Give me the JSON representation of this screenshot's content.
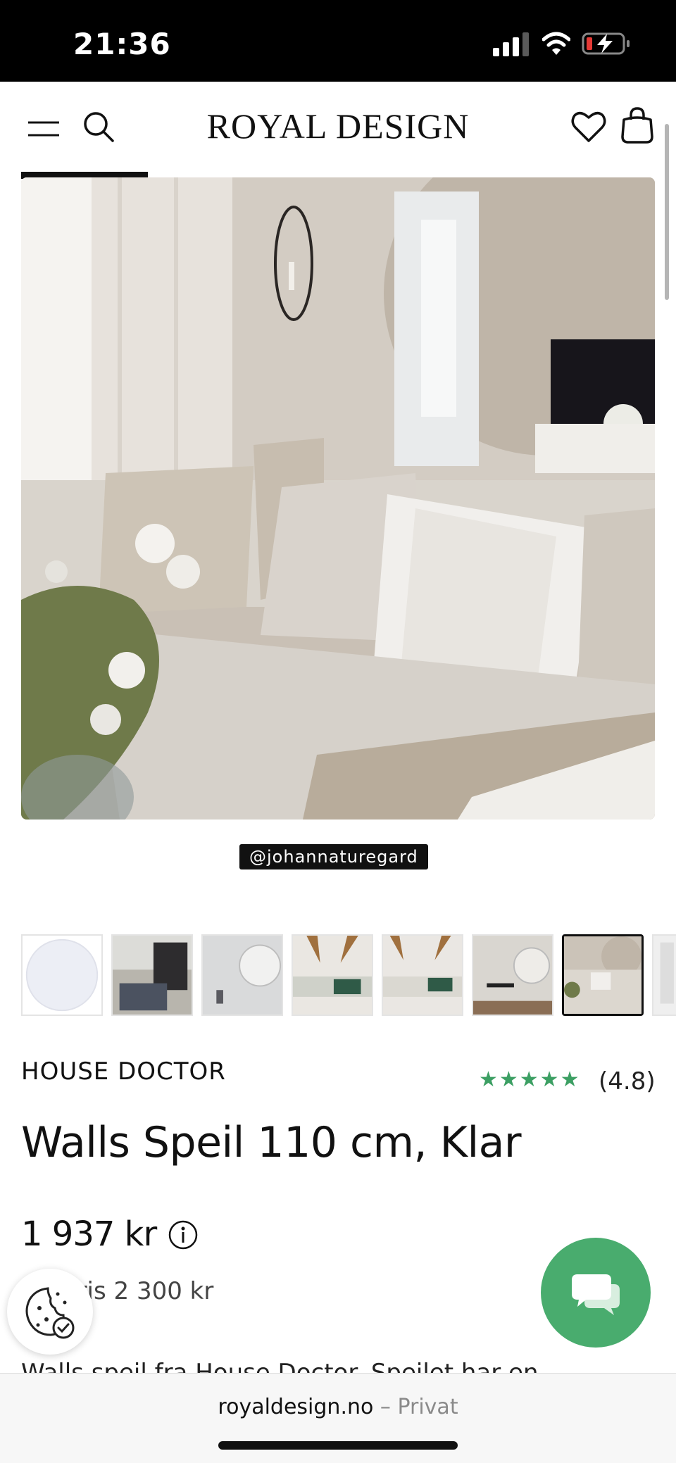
{
  "status_bar": {
    "time": "21:36"
  },
  "header": {
    "logo": "ROYAL DESIGN"
  },
  "gallery": {
    "progress_fraction": 0.2,
    "photo_credit": "@johannaturegard",
    "thumbnail_count": 8,
    "active_thumbnail_index": 6
  },
  "product": {
    "brand": "HOUSE DOCTOR",
    "stars": "★★★★★",
    "rating": "(4.8)",
    "title": "Walls Speil 110 cm, Klar",
    "price": "1 937 kr",
    "old_price": "pris 2 300 kr",
    "description": "Walls speil fra House Doctor. Speilet har en"
  },
  "browser": {
    "domain": "royaldesign.no",
    "mode": "– Privat"
  },
  "colors": {
    "accent_green": "#49ac6e",
    "star_green": "#3c9f63",
    "text": "#111111"
  }
}
